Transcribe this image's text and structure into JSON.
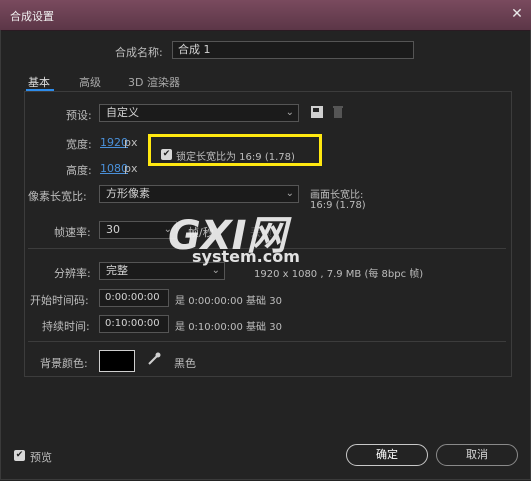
{
  "window": {
    "title": "合成设置"
  },
  "composition_name": {
    "label": "合成名称:",
    "value": "合成 1"
  },
  "tabs": [
    {
      "label": "基本",
      "active": true
    },
    {
      "label": "高级",
      "active": false
    },
    {
      "label": "3D 渲染器",
      "active": false
    }
  ],
  "preset": {
    "label": "预设:",
    "value": "自定义"
  },
  "width": {
    "label": "宽度:",
    "value": "1920",
    "unit": "px"
  },
  "height": {
    "label": "高度:",
    "value": "1080",
    "unit": "px"
  },
  "lock_aspect": {
    "label": "锁定长宽比为 16:9 (1.78)",
    "checked": true
  },
  "pixel_aspect": {
    "label": "像素长宽比:",
    "value": "方形像素"
  },
  "frame_aspect": {
    "label": "画面长宽比:",
    "value": "16:9 (1.78)"
  },
  "frame_rate": {
    "label": "帧速率:",
    "value": "30",
    "unit": "帧/秒",
    "drop_label": "丢帧"
  },
  "resolution": {
    "label": "分辨率:",
    "value": "完整",
    "info": "1920 x 1080 , 7.9 MB (每 8bpc 帧)"
  },
  "start_timecode": {
    "label": "开始时间码:",
    "value": "0:00:00:00",
    "note_prefix": "是",
    "note_value": "0:00:00:00",
    "base_label": "基础",
    "base_value": "30"
  },
  "duration": {
    "label": "持续时间:",
    "value": "0:10:00:00",
    "note_prefix": "是",
    "note_value": "0:10:00:00",
    "base_label": "基础",
    "base_value": "30"
  },
  "background": {
    "label": "背景颜色:",
    "color": "#000000",
    "color_name": "黑色"
  },
  "preview": {
    "label": "预览",
    "checked": true
  },
  "buttons": {
    "ok": "确定",
    "cancel": "取消"
  },
  "watermark": {
    "logo": "GXI网",
    "site": "system.com"
  },
  "colors": {
    "titlebar": "#6b3f52",
    "accent": "#2d8ceb",
    "highlight": "#ffe810",
    "link": "#4a90d9"
  }
}
